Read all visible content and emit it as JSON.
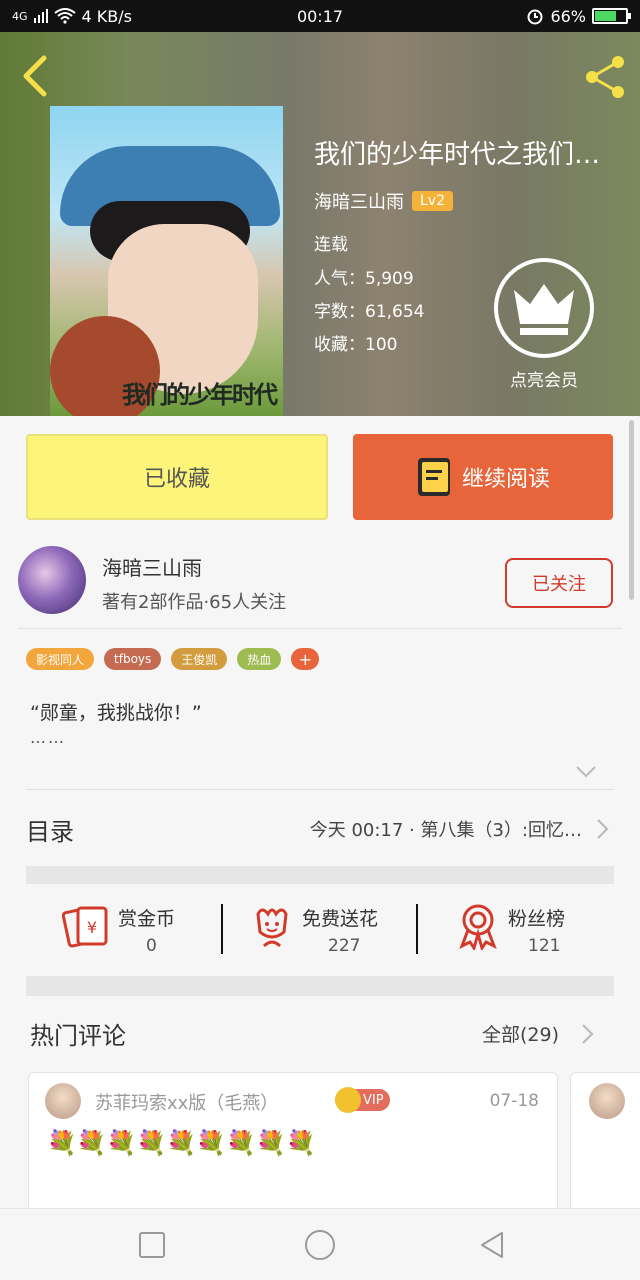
{
  "status_bar": {
    "network": "4G",
    "speed": "4 KB/s",
    "time": "00:17",
    "battery": "66%",
    "battery_level": 0.66
  },
  "book": {
    "title": "我们的少年时代之我们…",
    "cover_title": "我们的少年时代",
    "author": "海暗三山雨",
    "level": "Lv2",
    "status": "连载",
    "popularity": "人气：5,909",
    "word_count": "字数：61,654",
    "favorites": "收藏：100"
  },
  "vip": {
    "label": "点亮会员"
  },
  "buttons": {
    "collected": "已收藏",
    "continue_reading": "继续阅读",
    "followed": "已关注"
  },
  "author_info": {
    "name": "海暗三山雨",
    "stats": "著有2部作品·65人关注"
  },
  "tags": [
    {
      "label": "影视同人",
      "color": "#f2a63b"
    },
    {
      "label": "tfboys",
      "color": "#c56b51"
    },
    {
      "label": "王俊凯",
      "color": "#d39c3f"
    },
    {
      "label": "热血",
      "color": "#9ebc52"
    }
  ],
  "tag_more": "+",
  "intro": {
    "quote": "“郧童，我挑战你！”",
    "ellipsis": "……"
  },
  "catalog": {
    "label": "目录",
    "latest": "今天 00:17 · 第八集（3）:回忆…"
  },
  "actions": [
    {
      "label": "赏金币",
      "value": "0"
    },
    {
      "label": "免费送花",
      "value": "227"
    },
    {
      "label": "粉丝榜",
      "value": "121"
    }
  ],
  "hot_comments": {
    "title": "热门评论",
    "all": "全部(29)",
    "items": [
      {
        "user": "苏菲玛索xx版（毛燕）",
        "badge": "VIP",
        "date": "07-18",
        "flowers": "💐💐💐💐💐💐💐💐💐"
      }
    ]
  },
  "colors": {
    "accent_orange": "#e8643a",
    "collect_yellow": "#fdf57a",
    "follow_red": "#d23a2b"
  }
}
